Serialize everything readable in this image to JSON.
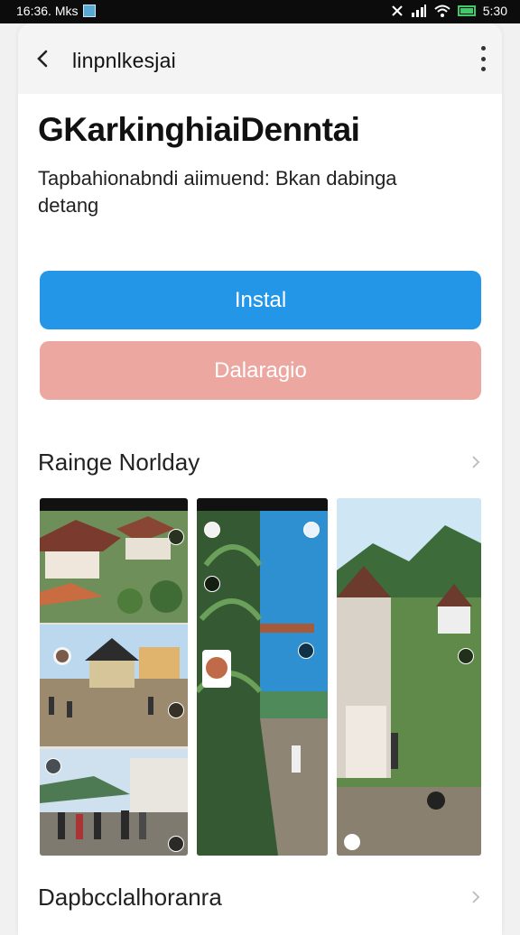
{
  "status_bar": {
    "time_left": "16:36. Mks",
    "time_right": "5:30"
  },
  "app_bar": {
    "title": "linpnlkesjai"
  },
  "app": {
    "title": "GKarkinghiaiDenntai",
    "description": "Tapbahionabndi aiimuend: Bkan dabinga detang"
  },
  "buttons": {
    "install": "Instal",
    "secondary": "Dalaragio"
  },
  "sections": {
    "screenshots_title": "Rainge Norlday",
    "second_title": "Dapbcclalhoranra"
  },
  "colors": {
    "primary": "#2496e8",
    "secondary": "#eca7a0",
    "background": "#ffffff"
  },
  "icons": [
    "back-arrow-icon",
    "more-vert-icon",
    "chevron-right-icon",
    "wifi-icon",
    "signal-icon",
    "battery-icon"
  ]
}
